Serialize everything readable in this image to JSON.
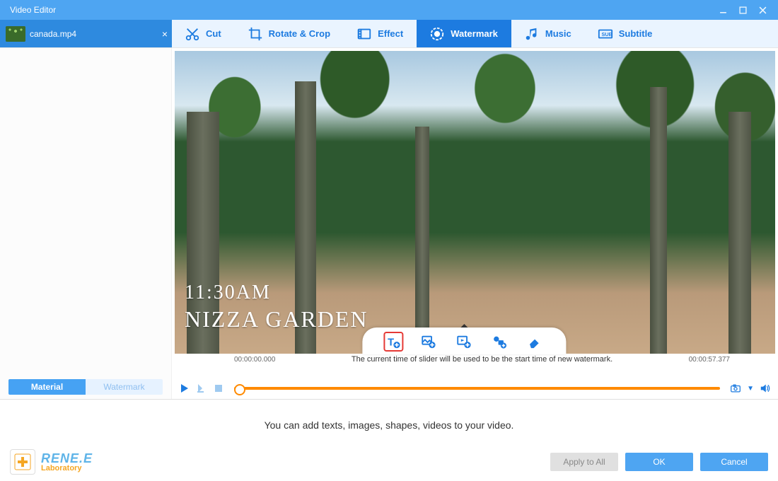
{
  "window": {
    "title": "Video Editor"
  },
  "file_tab": {
    "name": "canada.mp4"
  },
  "toolbar": {
    "cut": "Cut",
    "rotate": "Rotate & Crop",
    "effect": "Effect",
    "watermark": "Watermark",
    "music": "Music",
    "subtitle": "Subtitle",
    "active": "watermark"
  },
  "sidebar_tabs": {
    "material": "Material",
    "watermark": "Watermark",
    "active": "material"
  },
  "preview": {
    "overlay_time": "11:30AM",
    "overlay_title": "NIZZA GARDEN"
  },
  "overlay_toolbar": {
    "items": [
      "add-text",
      "add-image",
      "add-video",
      "add-shape",
      "erase"
    ],
    "selected": "add-text"
  },
  "timeline": {
    "help_text": "The current time of slider will be used to be the start time of new watermark.",
    "current": "00:00:00.000",
    "duration": "00:00:57.377"
  },
  "footer": {
    "hint": "You can add texts, images, shapes, videos to your video.",
    "apply_all": "Apply to All",
    "ok": "OK",
    "cancel": "Cancel",
    "brand_line1": "RENE.E",
    "brand_line2": "Laboratory"
  }
}
